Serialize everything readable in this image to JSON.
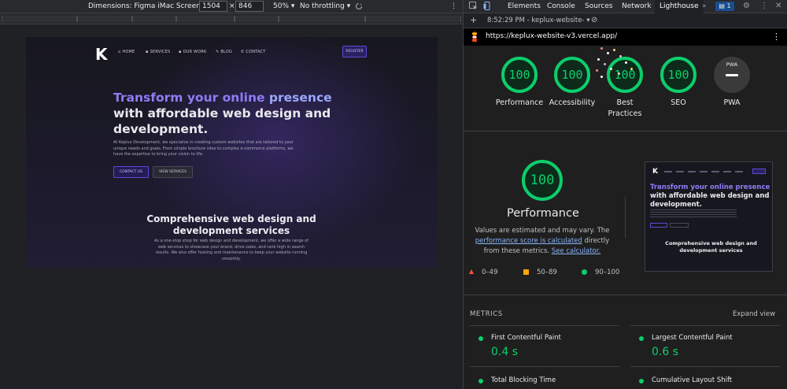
{
  "device_toolbar": {
    "dimensions_label": "Dimensions: Figma iMac Screen",
    "width": "1504",
    "height": "846",
    "zoom": "50%",
    "throttling": "No throttling",
    "times_sign": "×",
    "caret": "▾",
    "more_icon": "⋮"
  },
  "website": {
    "logo": "K",
    "nav": {
      "home": "HOME",
      "services": "SERVICES",
      "our_work": "OUR WORK",
      "blog": "BLOG",
      "contact": "CONTACT"
    },
    "register": "REGISTER",
    "hero": {
      "title_highlight_1": "Transform your online",
      "title_highlight_2": "presence",
      "title_rest": " with affordable web design and development.",
      "paragraph": "At Keplux Development, we specialize in creating custom websites that are tailored to your unique needs and goals. From simple brochure sites to complex e-commerce platforms, we have the expertise to bring your vision to life.",
      "contact_button": "CONTACT US",
      "services_button": "VIEW SERVICES"
    },
    "section": {
      "title": "Comprehensive web design and development services",
      "paragraph": "As a one-stop shop for web design and development, we offer a wide range of web services to showcase your brand, drive sales, and rank high in search results. We also offer hosting and maintenance to keep your website running smoothly."
    }
  },
  "devtools": {
    "tabs": [
      "Elements",
      "Console",
      "Sources",
      "Network",
      "Lighthouse"
    ],
    "active_tab": "Lighthouse",
    "more_tabs": "»",
    "issues_count": "1",
    "lighthouse_bar": {
      "time_label": "8:52:29 PM - keplux-website-",
      "add": "+",
      "caret": "▾",
      "clear_icon": "⊘"
    },
    "url": "https://keplux-website-v3.vercel.app/",
    "share_icon": "⋮"
  },
  "lighthouse": {
    "summary": [
      {
        "label": "Performance",
        "score": "100"
      },
      {
        "label": "Accessibility",
        "score": "100"
      },
      {
        "label": "Best Practices",
        "score": "100"
      },
      {
        "label": "SEO",
        "score": "100"
      }
    ],
    "pwa": {
      "label": "PWA",
      "badge": "PWA"
    },
    "performance": {
      "score": "100",
      "title": "Performance",
      "note_1": "Values are estimated and may vary. The",
      "note_link_1": "performance score is calculated",
      "note_2": " directly from these metrics. ",
      "note_link_2": "See calculator."
    },
    "legend": {
      "fail": "0–49",
      "average": "50–89",
      "pass": "90–100"
    },
    "thumbnail": {
      "logo": "K",
      "title_highlight": "Transform your online presence",
      "title_rest": " with affordable web design and development.",
      "section_title": "Comprehensive web design and development services"
    },
    "metrics_header": "METRICS",
    "expand_view": "Expand view",
    "metrics": [
      {
        "name": "First Contentful Paint",
        "value": "0.4 s"
      },
      {
        "name": "Largest Contentful Paint",
        "value": "0.6 s"
      },
      {
        "name": "Total Blocking Time",
        "value": ""
      },
      {
        "name": "Cumulative Layout Shift",
        "value": ""
      }
    ],
    "colors": {
      "pass": "#0cce6b",
      "average": "#ffa400",
      "fail": "#ff4e42"
    }
  }
}
